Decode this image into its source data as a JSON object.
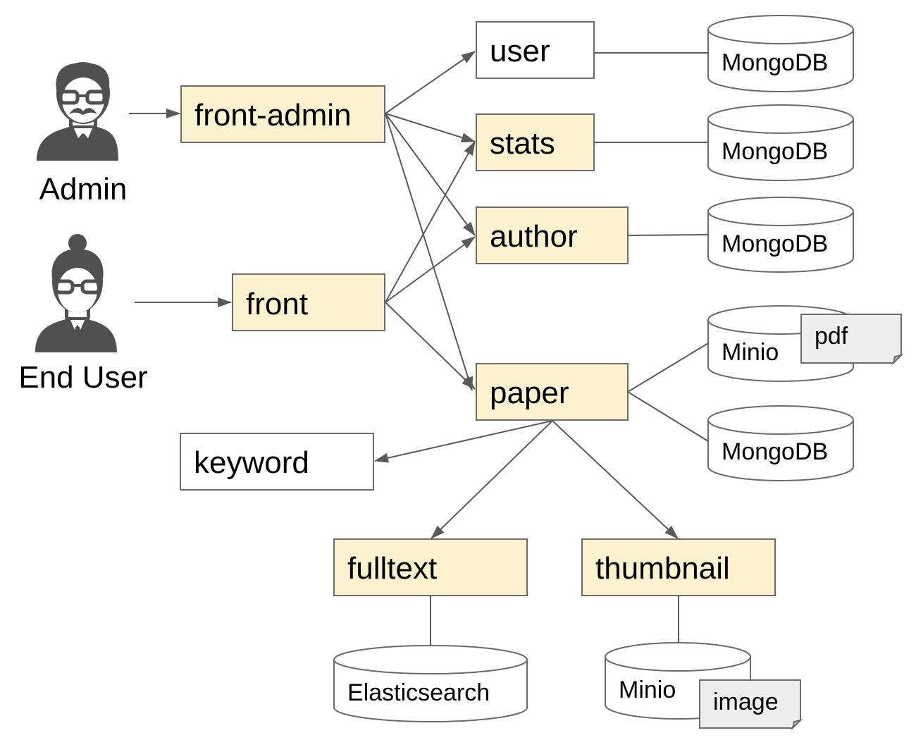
{
  "actors": {
    "admin": {
      "label": "Admin",
      "icon": "admin-person-icon"
    },
    "end_user": {
      "label": "End User",
      "icon": "end-user-person-icon"
    }
  },
  "services": {
    "front_admin": "front-admin",
    "front": "front",
    "user": "user",
    "stats": "stats",
    "author": "author",
    "paper": "paper",
    "keyword": "keyword",
    "fulltext": "fulltext",
    "thumbnail": "thumbnail"
  },
  "stores": {
    "user_db": "MongoDB",
    "stats_db": "MongoDB",
    "author_db": "MongoDB",
    "paper_minio": "Minio",
    "paper_minio_doc": "pdf",
    "paper_db": "MongoDB",
    "fulltext_store": "Elasticsearch",
    "thumbnail_minio": "Minio",
    "thumbnail_minio_doc": "image"
  },
  "edges": [
    {
      "from": "Admin",
      "to": "front-admin",
      "type": "arrow"
    },
    {
      "from": "End User",
      "to": "front",
      "type": "arrow"
    },
    {
      "from": "front-admin",
      "to": "user",
      "type": "arrow"
    },
    {
      "from": "front-admin",
      "to": "stats",
      "type": "arrow"
    },
    {
      "from": "front-admin",
      "to": "author",
      "type": "arrow"
    },
    {
      "from": "front-admin",
      "to": "paper",
      "type": "arrow"
    },
    {
      "from": "front",
      "to": "stats",
      "type": "arrow"
    },
    {
      "from": "front",
      "to": "author",
      "type": "arrow"
    },
    {
      "from": "front",
      "to": "paper",
      "type": "arrow"
    },
    {
      "from": "paper",
      "to": "keyword",
      "type": "arrow"
    },
    {
      "from": "paper",
      "to": "fulltext",
      "type": "arrow"
    },
    {
      "from": "paper",
      "to": "thumbnail",
      "type": "arrow"
    },
    {
      "from": "user",
      "to": "MongoDB",
      "type": "line"
    },
    {
      "from": "stats",
      "to": "MongoDB",
      "type": "line"
    },
    {
      "from": "author",
      "to": "MongoDB",
      "type": "line"
    },
    {
      "from": "paper",
      "to": "Minio (pdf)",
      "type": "line"
    },
    {
      "from": "paper",
      "to": "MongoDB",
      "type": "line"
    },
    {
      "from": "fulltext",
      "to": "Elasticsearch",
      "type": "line"
    },
    {
      "from": "thumbnail",
      "to": "Minio (image)",
      "type": "line"
    }
  ],
  "colors": {
    "service_fill": "#fdf2d0",
    "plain_fill": "#ffffff",
    "stroke": "#6b6b6b",
    "doc_fill": "#eeeeee",
    "person": "#505050"
  }
}
